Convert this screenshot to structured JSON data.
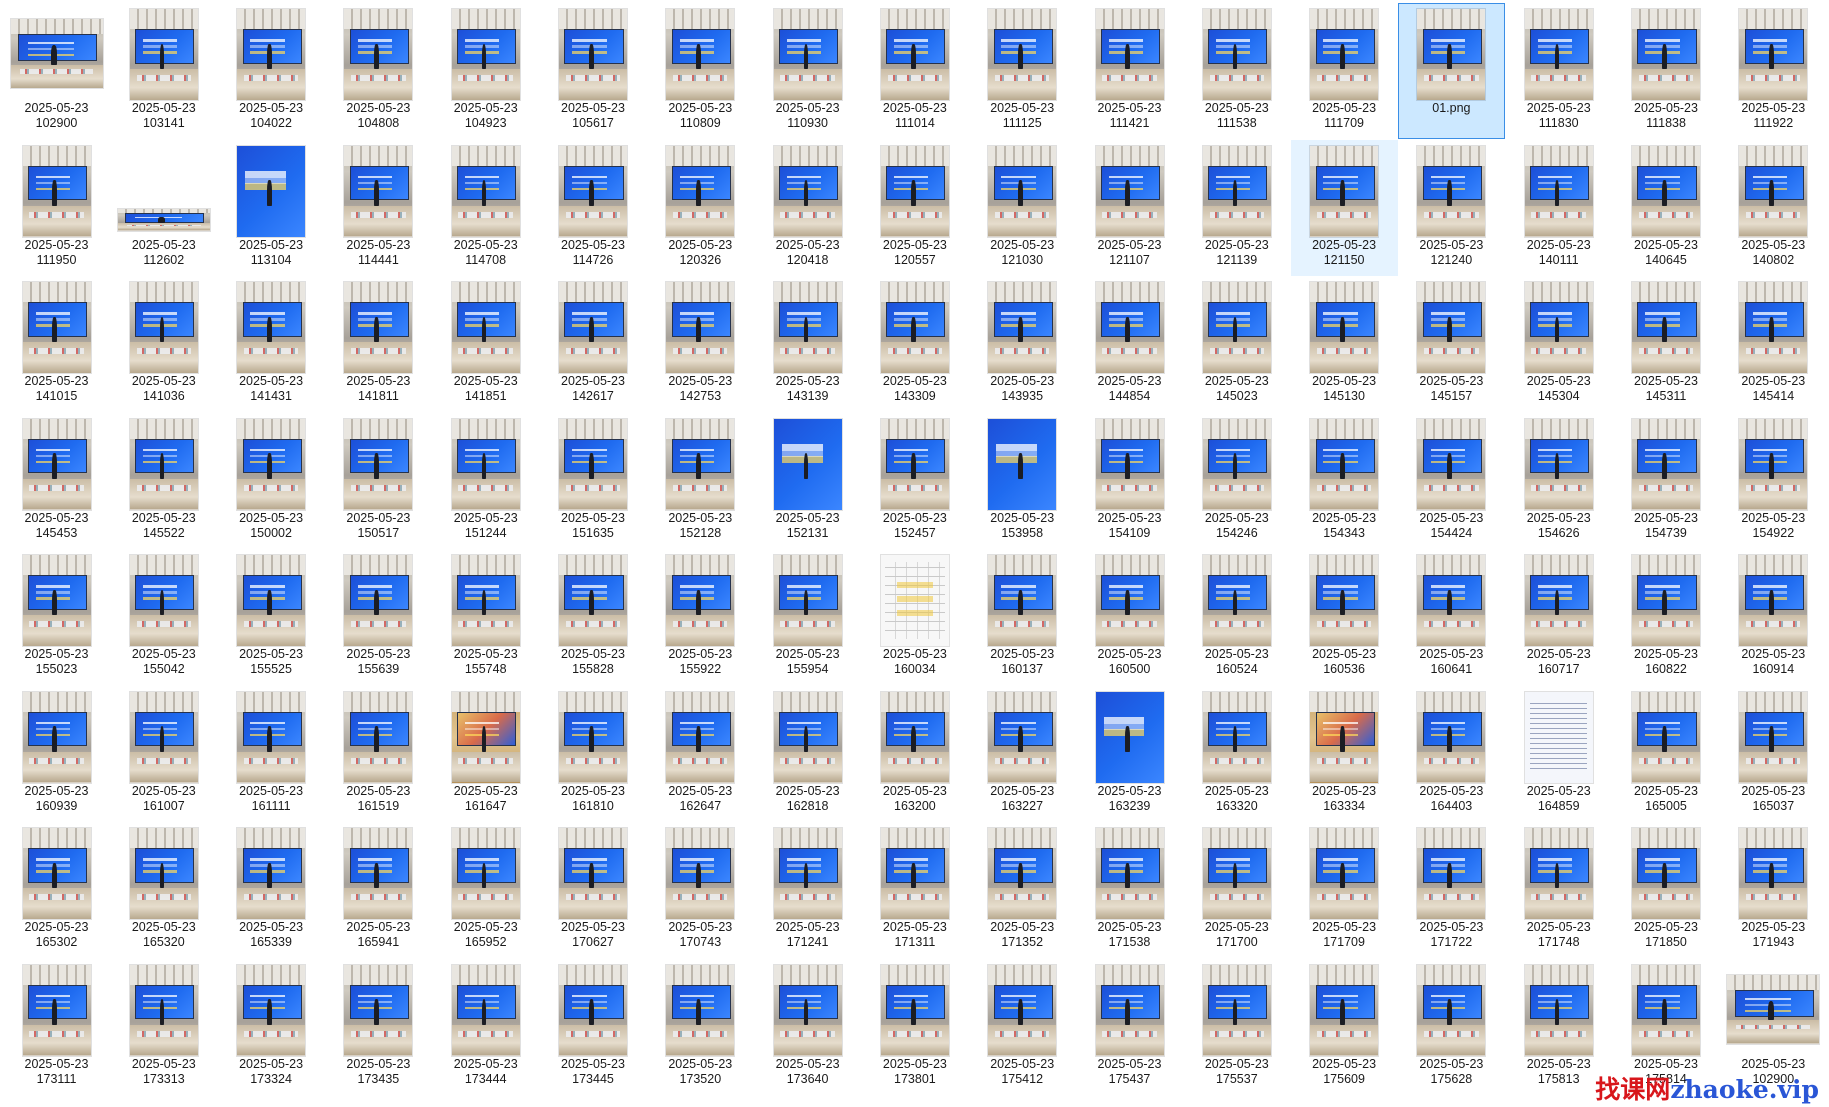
{
  "files": [
    {
      "l1": "2025-05-23",
      "l2": "102900",
      "kind": "land"
    },
    {
      "l1": "2025-05-23",
      "l2": "103141",
      "kind": "photo"
    },
    {
      "l1": "2025-05-23",
      "l2": "104022",
      "kind": "photo"
    },
    {
      "l1": "2025-05-23",
      "l2": "104808",
      "kind": "photo"
    },
    {
      "l1": "2025-05-23",
      "l2": "104923",
      "kind": "photo"
    },
    {
      "l1": "2025-05-23",
      "l2": "105617",
      "kind": "photo"
    },
    {
      "l1": "2025-05-23",
      "l2": "110809",
      "kind": "photo"
    },
    {
      "l1": "2025-05-23",
      "l2": "110930",
      "kind": "photo"
    },
    {
      "l1": "2025-05-23",
      "l2": "111014",
      "kind": "photo"
    },
    {
      "l1": "2025-05-23",
      "l2": "111125",
      "kind": "photo"
    },
    {
      "l1": "2025-05-23",
      "l2": "111421",
      "kind": "photo"
    },
    {
      "l1": "2025-05-23",
      "l2": "111538",
      "kind": "photo"
    },
    {
      "l1": "2025-05-23",
      "l2": "111709",
      "kind": "photo"
    },
    {
      "l1": "01.png",
      "l2": "",
      "kind": "photo",
      "state": "selected"
    },
    {
      "l1": "2025-05-23",
      "l2": "111830",
      "kind": "photo"
    },
    {
      "l1": "2025-05-23",
      "l2": "111838",
      "kind": "photo"
    },
    {
      "l1": "2025-05-23",
      "l2": "111922",
      "kind": "photo"
    },
    {
      "l1": "2025-05-23",
      "l2": "111950",
      "kind": "photo"
    },
    {
      "l1": "2025-05-23",
      "l2": "112602",
      "kind": "flat"
    },
    {
      "l1": "2025-05-23",
      "l2": "113104",
      "kind": "bluefull"
    },
    {
      "l1": "2025-05-23",
      "l2": "114441",
      "kind": "photo"
    },
    {
      "l1": "2025-05-23",
      "l2": "114708",
      "kind": "photo"
    },
    {
      "l1": "2025-05-23",
      "l2": "114726",
      "kind": "photo"
    },
    {
      "l1": "2025-05-23",
      "l2": "120326",
      "kind": "photo"
    },
    {
      "l1": "2025-05-23",
      "l2": "120418",
      "kind": "photo"
    },
    {
      "l1": "2025-05-23",
      "l2": "120557",
      "kind": "photo"
    },
    {
      "l1": "2025-05-23",
      "l2": "121030",
      "kind": "photo"
    },
    {
      "l1": "2025-05-23",
      "l2": "121107",
      "kind": "photo"
    },
    {
      "l1": "2025-05-23",
      "l2": "121139",
      "kind": "photo"
    },
    {
      "l1": "2025-05-23",
      "l2": "121150",
      "kind": "photo",
      "state": "hover"
    },
    {
      "l1": "2025-05-23",
      "l2": "121240",
      "kind": "photo"
    },
    {
      "l1": "2025-05-23",
      "l2": "140111",
      "kind": "photo"
    },
    {
      "l1": "2025-05-23",
      "l2": "140645",
      "kind": "photo"
    },
    {
      "l1": "2025-05-23",
      "l2": "140802",
      "kind": "photo"
    },
    {
      "l1": "2025-05-23",
      "l2": "141015",
      "kind": "photo"
    },
    {
      "l1": "2025-05-23",
      "l2": "141036",
      "kind": "photo"
    },
    {
      "l1": "2025-05-23",
      "l2": "141431",
      "kind": "photo"
    },
    {
      "l1": "2025-05-23",
      "l2": "141811",
      "kind": "photo"
    },
    {
      "l1": "2025-05-23",
      "l2": "141851",
      "kind": "photo"
    },
    {
      "l1": "2025-05-23",
      "l2": "142617",
      "kind": "photo"
    },
    {
      "l1": "2025-05-23",
      "l2": "142753",
      "kind": "photo"
    },
    {
      "l1": "2025-05-23",
      "l2": "143139",
      "kind": "photo"
    },
    {
      "l1": "2025-05-23",
      "l2": "143309",
      "kind": "photo"
    },
    {
      "l1": "2025-05-23",
      "l2": "143935",
      "kind": "photo"
    },
    {
      "l1": "2025-05-23",
      "l2": "144854",
      "kind": "photo"
    },
    {
      "l1": "2025-05-23",
      "l2": "145023",
      "kind": "photo"
    },
    {
      "l1": "2025-05-23",
      "l2": "145130",
      "kind": "photo"
    },
    {
      "l1": "2025-05-23",
      "l2": "145157",
      "kind": "photo"
    },
    {
      "l1": "2025-05-23",
      "l2": "145304",
      "kind": "photo"
    },
    {
      "l1": "2025-05-23",
      "l2": "145311",
      "kind": "photo"
    },
    {
      "l1": "2025-05-23",
      "l2": "145414",
      "kind": "photo"
    },
    {
      "l1": "2025-05-23",
      "l2": "145453",
      "kind": "photo"
    },
    {
      "l1": "2025-05-23",
      "l2": "145522",
      "kind": "photo"
    },
    {
      "l1": "2025-05-23",
      "l2": "150002",
      "kind": "photo"
    },
    {
      "l1": "2025-05-23",
      "l2": "150517",
      "kind": "photo"
    },
    {
      "l1": "2025-05-23",
      "l2": "151244",
      "kind": "photo"
    },
    {
      "l1": "2025-05-23",
      "l2": "151635",
      "kind": "photo"
    },
    {
      "l1": "2025-05-23",
      "l2": "152128",
      "kind": "photo"
    },
    {
      "l1": "2025-05-23",
      "l2": "152131",
      "kind": "bluefull"
    },
    {
      "l1": "2025-05-23",
      "l2": "152457",
      "kind": "photo"
    },
    {
      "l1": "2025-05-23",
      "l2": "153958",
      "kind": "bluefull"
    },
    {
      "l1": "2025-05-23",
      "l2": "154109",
      "kind": "photo"
    },
    {
      "l1": "2025-05-23",
      "l2": "154246",
      "kind": "photo"
    },
    {
      "l1": "2025-05-23",
      "l2": "154343",
      "kind": "photo"
    },
    {
      "l1": "2025-05-23",
      "l2": "154424",
      "kind": "photo"
    },
    {
      "l1": "2025-05-23",
      "l2": "154626",
      "kind": "photo"
    },
    {
      "l1": "2025-05-23",
      "l2": "154739",
      "kind": "photo"
    },
    {
      "l1": "2025-05-23",
      "l2": "154922",
      "kind": "photo"
    },
    {
      "l1": "2025-05-23",
      "l2": "155023",
      "kind": "photo"
    },
    {
      "l1": "2025-05-23",
      "l2": "155042",
      "kind": "photo"
    },
    {
      "l1": "2025-05-23",
      "l2": "155525",
      "kind": "photo"
    },
    {
      "l1": "2025-05-23",
      "l2": "155639",
      "kind": "photo"
    },
    {
      "l1": "2025-05-23",
      "l2": "155748",
      "kind": "photo"
    },
    {
      "l1": "2025-05-23",
      "l2": "155828",
      "kind": "photo"
    },
    {
      "l1": "2025-05-23",
      "l2": "155922",
      "kind": "photo"
    },
    {
      "l1": "2025-05-23",
      "l2": "155954",
      "kind": "photo"
    },
    {
      "l1": "2025-05-23",
      "l2": "160034",
      "kind": "doc"
    },
    {
      "l1": "2025-05-23",
      "l2": "160137",
      "kind": "photo"
    },
    {
      "l1": "2025-05-23",
      "l2": "160500",
      "kind": "photo"
    },
    {
      "l1": "2025-05-23",
      "l2": "160524",
      "kind": "photo"
    },
    {
      "l1": "2025-05-23",
      "l2": "160536",
      "kind": "photo"
    },
    {
      "l1": "2025-05-23",
      "l2": "160641",
      "kind": "photo"
    },
    {
      "l1": "2025-05-23",
      "l2": "160717",
      "kind": "photo"
    },
    {
      "l1": "2025-05-23",
      "l2": "160822",
      "kind": "photo"
    },
    {
      "l1": "2025-05-23",
      "l2": "160914",
      "kind": "photo"
    },
    {
      "l1": "2025-05-23",
      "l2": "160939",
      "kind": "photo"
    },
    {
      "l1": "2025-05-23",
      "l2": "161007",
      "kind": "photo"
    },
    {
      "l1": "2025-05-23",
      "l2": "161111",
      "kind": "photo"
    },
    {
      "l1": "2025-05-23",
      "l2": "161519",
      "kind": "photo"
    },
    {
      "l1": "2025-05-23",
      "l2": "161647",
      "kind": "warm"
    },
    {
      "l1": "2025-05-23",
      "l2": "161810",
      "kind": "photo"
    },
    {
      "l1": "2025-05-23",
      "l2": "162647",
      "kind": "photo"
    },
    {
      "l1": "2025-05-23",
      "l2": "162818",
      "kind": "photo"
    },
    {
      "l1": "2025-05-23",
      "l2": "163200",
      "kind": "photo"
    },
    {
      "l1": "2025-05-23",
      "l2": "163227",
      "kind": "photo"
    },
    {
      "l1": "2025-05-23",
      "l2": "163239",
      "kind": "bluefull"
    },
    {
      "l1": "2025-05-23",
      "l2": "163320",
      "kind": "photo"
    },
    {
      "l1": "2025-05-23",
      "l2": "163334",
      "kind": "warm"
    },
    {
      "l1": "2025-05-23",
      "l2": "164403",
      "kind": "photo"
    },
    {
      "l1": "2025-05-23",
      "l2": "164859",
      "kind": "textdoc"
    },
    {
      "l1": "2025-05-23",
      "l2": "165005",
      "kind": "photo"
    },
    {
      "l1": "2025-05-23",
      "l2": "165037",
      "kind": "photo"
    },
    {
      "l1": "2025-05-23",
      "l2": "165302",
      "kind": "photo"
    },
    {
      "l1": "2025-05-23",
      "l2": "165320",
      "kind": "photo"
    },
    {
      "l1": "2025-05-23",
      "l2": "165339",
      "kind": "photo"
    },
    {
      "l1": "2025-05-23",
      "l2": "165941",
      "kind": "photo"
    },
    {
      "l1": "2025-05-23",
      "l2": "165952",
      "kind": "photo"
    },
    {
      "l1": "2025-05-23",
      "l2": "170627",
      "kind": "photo"
    },
    {
      "l1": "2025-05-23",
      "l2": "170743",
      "kind": "photo"
    },
    {
      "l1": "2025-05-23",
      "l2": "171241",
      "kind": "photo"
    },
    {
      "l1": "2025-05-23",
      "l2": "171311",
      "kind": "photo"
    },
    {
      "l1": "2025-05-23",
      "l2": "171352",
      "kind": "photo"
    },
    {
      "l1": "2025-05-23",
      "l2": "171538",
      "kind": "photo"
    },
    {
      "l1": "2025-05-23",
      "l2": "171700",
      "kind": "photo"
    },
    {
      "l1": "2025-05-23",
      "l2": "171709",
      "kind": "photo"
    },
    {
      "l1": "2025-05-23",
      "l2": "171722",
      "kind": "photo"
    },
    {
      "l1": "2025-05-23",
      "l2": "171748",
      "kind": "photo"
    },
    {
      "l1": "2025-05-23",
      "l2": "171850",
      "kind": "photo"
    },
    {
      "l1": "2025-05-23",
      "l2": "171943",
      "kind": "photo"
    },
    {
      "l1": "2025-05-23",
      "l2": "173111",
      "kind": "photo"
    },
    {
      "l1": "2025-05-23",
      "l2": "173313",
      "kind": "photo"
    },
    {
      "l1": "2025-05-23",
      "l2": "173324",
      "kind": "photo"
    },
    {
      "l1": "2025-05-23",
      "l2": "173435",
      "kind": "photo"
    },
    {
      "l1": "2025-05-23",
      "l2": "173444",
      "kind": "photo"
    },
    {
      "l1": "2025-05-23",
      "l2": "173445",
      "kind": "photo"
    },
    {
      "l1": "2025-05-23",
      "l2": "173520",
      "kind": "photo"
    },
    {
      "l1": "2025-05-23",
      "l2": "173640",
      "kind": "photo"
    },
    {
      "l1": "2025-05-23",
      "l2": "173801",
      "kind": "photo"
    },
    {
      "l1": "2025-05-23",
      "l2": "175412",
      "kind": "photo"
    },
    {
      "l1": "2025-05-23",
      "l2": "175437",
      "kind": "photo"
    },
    {
      "l1": "2025-05-23",
      "l2": "175537",
      "kind": "photo"
    },
    {
      "l1": "2025-05-23",
      "l2": "175609",
      "kind": "photo"
    },
    {
      "l1": "2025-05-23",
      "l2": "175628",
      "kind": "photo"
    },
    {
      "l1": "2025-05-23",
      "l2": "175813",
      "kind": "photo"
    },
    {
      "l1": "2025-05-23",
      "l2": "175814",
      "kind": "photo"
    },
    {
      "l1": "2025-05-23",
      "l2": "102900",
      "kind": "land"
    }
  ],
  "watermark": {
    "cn": "找课网",
    "en": "zhaoke.vip"
  },
  "colors": {
    "selection": "#cce8ff",
    "selection_border": "#3a8ee6",
    "hover": "#e5f3ff",
    "watermark_red": "#d8161b",
    "watermark_blue": "#2a56d6"
  }
}
